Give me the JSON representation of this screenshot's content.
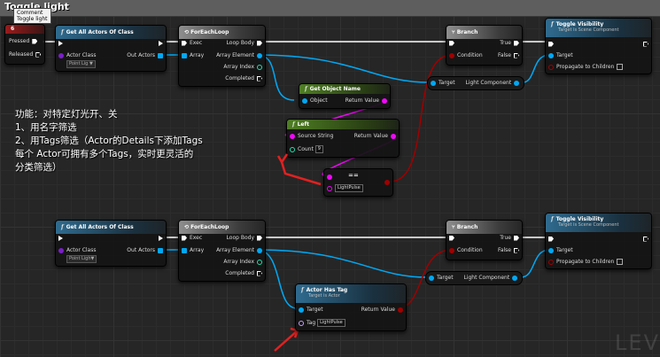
{
  "group": {
    "title": "Toggle light"
  },
  "event": {
    "label": "Pressed",
    "label2": "Released",
    "key": "6",
    "comment_line1": "Comment",
    "comment_line2": "Toggle light"
  },
  "get_all_actors": {
    "title": "Get All Actors Of Class",
    "actor_class_label": "Actor Class",
    "actor_class_value": "Point Lig ▼",
    "actor_class_value_b": "Point Ligh▼",
    "out_actors_label": "Out Actors"
  },
  "foreach": {
    "title": "ForEachLoop",
    "exec_label": "Exec",
    "array_label": "Array",
    "loop_body_label": "Loop Body",
    "array_element_label": "Array Element",
    "array_index_label": "Array Index",
    "completed_label": "Completed"
  },
  "branch": {
    "title": "Branch",
    "true_label": "True",
    "false_label": "False",
    "condition_label": "Condition"
  },
  "toggle_visibility": {
    "title": "Toggle Visibility",
    "subtitle": "Target is Scene Component",
    "target_label": "Target",
    "propagate_label": "Propagate to Children"
  },
  "light_component": {
    "target_label": "Target",
    "output_label": "Light Component"
  },
  "get_object_name": {
    "title": "Get Object Name",
    "object_label": "Object",
    "return_label": "Return Value"
  },
  "left": {
    "title": "Left",
    "source_label": "Source String",
    "return_label": "Return Value",
    "count_label": "Count",
    "count_value": "9"
  },
  "equal": {
    "title": "==",
    "value": "LightPulse"
  },
  "actor_has_tag": {
    "title": "Actor Has Tag",
    "subtitle": "Target is Actor",
    "target_label": "Target",
    "tag_label": "Tag",
    "tag_value": "LightPulse",
    "return_label": "Return Value"
  },
  "notes": {
    "line1": "功能：对特定灯光开、关",
    "line2": "1、用名字筛选",
    "line3": "2、用Tags筛选（Actor的Details下添加Tags",
    "line4": "每个 Actor可拥有多个Tags，实时更灵活的",
    "line5": "分类筛选）"
  },
  "watermark": "LEV",
  "colors": {
    "exec": "#ffffff",
    "object": "#00a8f4",
    "string": "#f008f8",
    "bool": "#a00000",
    "int": "#1fe3af",
    "array": "#00a8f4",
    "accent": "#e32020"
  }
}
